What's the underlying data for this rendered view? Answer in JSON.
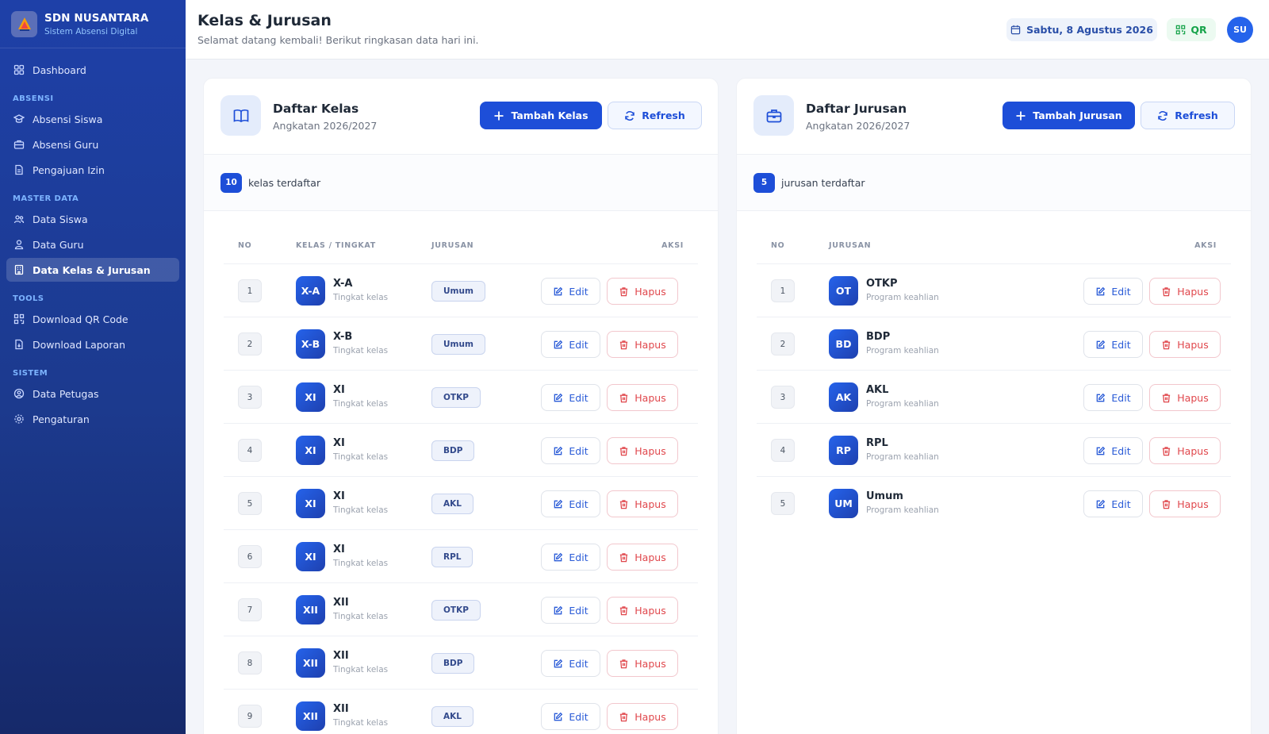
{
  "app": {
    "name": "SDN NUSANTARA",
    "subtitle": "Sistem Absensi Digital"
  },
  "sidebar": {
    "dashboard": "Dashboard",
    "sections": [
      {
        "title": "ABSENSI",
        "items": [
          {
            "label": "Absensi Siswa",
            "icon": "students-icon"
          },
          {
            "label": "Absensi Guru",
            "icon": "briefcase-icon"
          },
          {
            "label": "Pengajuan Izin",
            "icon": "document-icon"
          }
        ]
      },
      {
        "title": "MASTER DATA",
        "items": [
          {
            "label": "Data Siswa",
            "icon": "users-icon"
          },
          {
            "label": "Data Guru",
            "icon": "user-icon"
          },
          {
            "label": "Data Kelas & Jurusan",
            "icon": "building-icon",
            "active": true
          }
        ]
      },
      {
        "title": "TOOLS",
        "items": [
          {
            "label": "Download QR Code",
            "icon": "qr-icon"
          },
          {
            "label": "Download Laporan",
            "icon": "file-icon"
          }
        ]
      },
      {
        "title": "SISTEM",
        "items": [
          {
            "label": "Data Petugas",
            "icon": "user-circle-icon"
          },
          {
            "label": "Pengaturan",
            "icon": "gear-icon"
          }
        ]
      }
    ]
  },
  "header": {
    "title": "Kelas & Jurusan",
    "subtitle": "Selamat datang kembali! Berikut ringkasan data hari ini.",
    "date": "Sabtu, 8 Agustus 2026",
    "qr_label": "QR",
    "avatar_initials": "SU"
  },
  "kelas": {
    "title": "Daftar Kelas",
    "subtitle": "Angkatan 2026/2027",
    "add_label": "Tambah Kelas",
    "refresh_label": "Refresh",
    "count": "10",
    "count_label": "kelas terdaftar",
    "columns": {
      "no": "NO",
      "kelas": "KELAS / TINGKAT",
      "jurusan": "JURUSAN",
      "aksi": "AKSI"
    },
    "row_sub": "Tingkat kelas",
    "rows": [
      {
        "no": "1",
        "badge": "X-A",
        "name": "X-A",
        "jurusan": "Umum"
      },
      {
        "no": "2",
        "badge": "X-B",
        "name": "X-B",
        "jurusan": "Umum"
      },
      {
        "no": "3",
        "badge": "XI",
        "name": "XI",
        "jurusan": "OTKP"
      },
      {
        "no": "4",
        "badge": "XI",
        "name": "XI",
        "jurusan": "BDP"
      },
      {
        "no": "5",
        "badge": "XI",
        "name": "XI",
        "jurusan": "AKL"
      },
      {
        "no": "6",
        "badge": "XI",
        "name": "XI",
        "jurusan": "RPL"
      },
      {
        "no": "7",
        "badge": "XII",
        "name": "XII",
        "jurusan": "OTKP"
      },
      {
        "no": "8",
        "badge": "XII",
        "name": "XII",
        "jurusan": "BDP"
      },
      {
        "no": "9",
        "badge": "XII",
        "name": "XII",
        "jurusan": "AKL"
      }
    ]
  },
  "jurusan": {
    "title": "Daftar Jurusan",
    "subtitle": "Angkatan 2026/2027",
    "add_label": "Tambah Jurusan",
    "refresh_label": "Refresh",
    "count": "5",
    "count_label": "jurusan terdaftar",
    "columns": {
      "no": "NO",
      "jurusan": "JURUSAN",
      "aksi": "AKSI"
    },
    "row_sub": "Program keahlian",
    "rows": [
      {
        "no": "1",
        "badge": "OT",
        "name": "OTKP"
      },
      {
        "no": "2",
        "badge": "BD",
        "name": "BDP"
      },
      {
        "no": "3",
        "badge": "AK",
        "name": "AKL"
      },
      {
        "no": "4",
        "badge": "RP",
        "name": "RPL"
      },
      {
        "no": "5",
        "badge": "UM",
        "name": "Umum"
      }
    ]
  },
  "actions": {
    "edit": "Edit",
    "delete": "Hapus"
  },
  "colors": {
    "primary": "#1d4ed8",
    "sidebar": "#1e40a8",
    "danger": "#e0474c",
    "success": "#16a34a"
  }
}
